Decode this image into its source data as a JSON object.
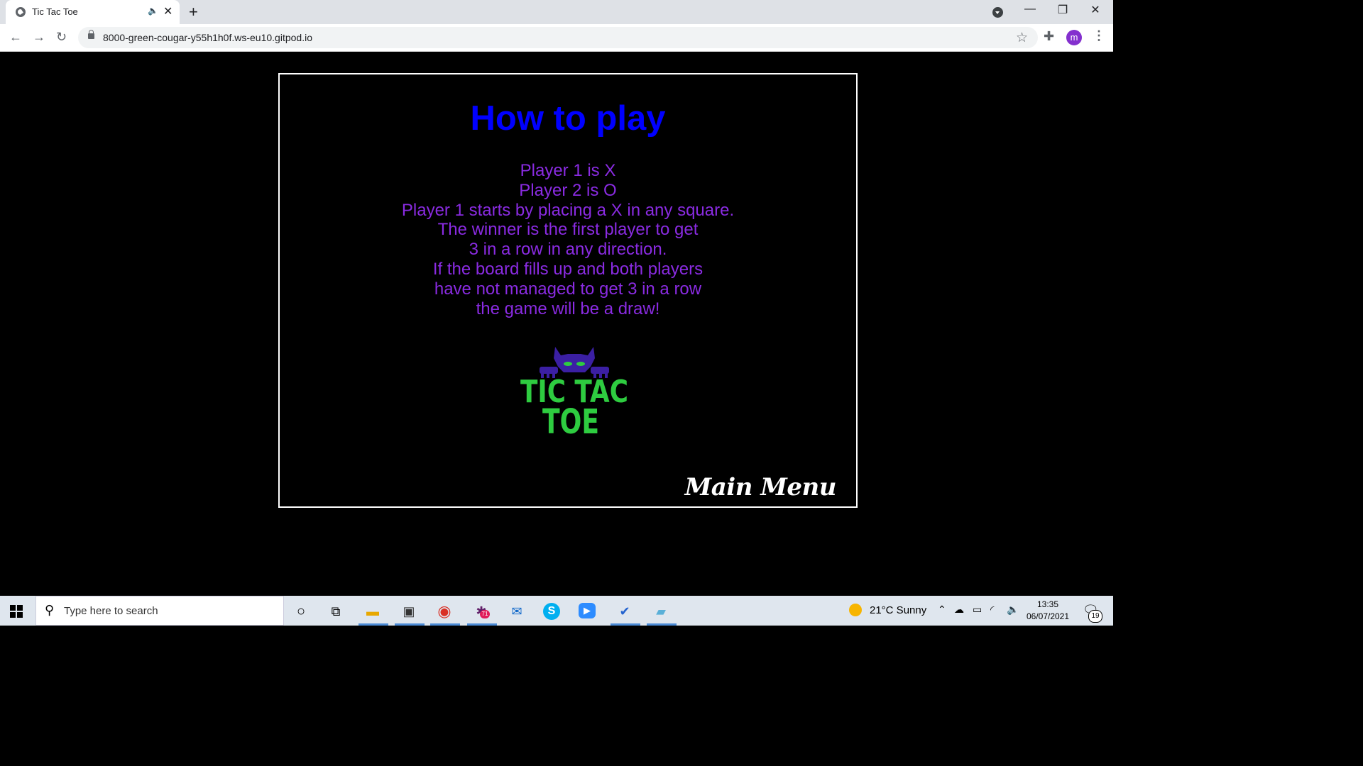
{
  "browser": {
    "tab_title": "Tic Tac Toe",
    "tab_audio_icon": "speaker-icon",
    "tab_close": "✕",
    "new_tab": "+",
    "url": "8000-green-cougar-y55h1h0f.ws-eu10.gitpod.io",
    "profile_initial": "m",
    "window_minimize": "—",
    "window_restore": "❐",
    "window_close": "✕"
  },
  "page": {
    "title": "How to play",
    "rules": [
      "Player 1 is X",
      "Player 2 is O",
      "Player 1 starts by placing a X in any square.",
      "The winner is the first player to get",
      "3 in a row in any direction.",
      "If the board fills up and both players",
      "have not managed to get 3 in a row",
      "the game will be a draw!"
    ],
    "logo_line1": "TIC TAC",
    "logo_line2": "TOE",
    "main_menu_label": "Main Menu"
  },
  "colors": {
    "title": "#0000ff",
    "rules": "#8a2be2",
    "logo_text": "#2ecc40",
    "logo_mascot": "#3b1fa3"
  },
  "taskbar": {
    "search_placeholder": "Type here to search",
    "weather": "21°C  Sunny",
    "time": "13:35",
    "date": "06/07/2021",
    "slack_badge": "71",
    "notification_count": "19"
  }
}
